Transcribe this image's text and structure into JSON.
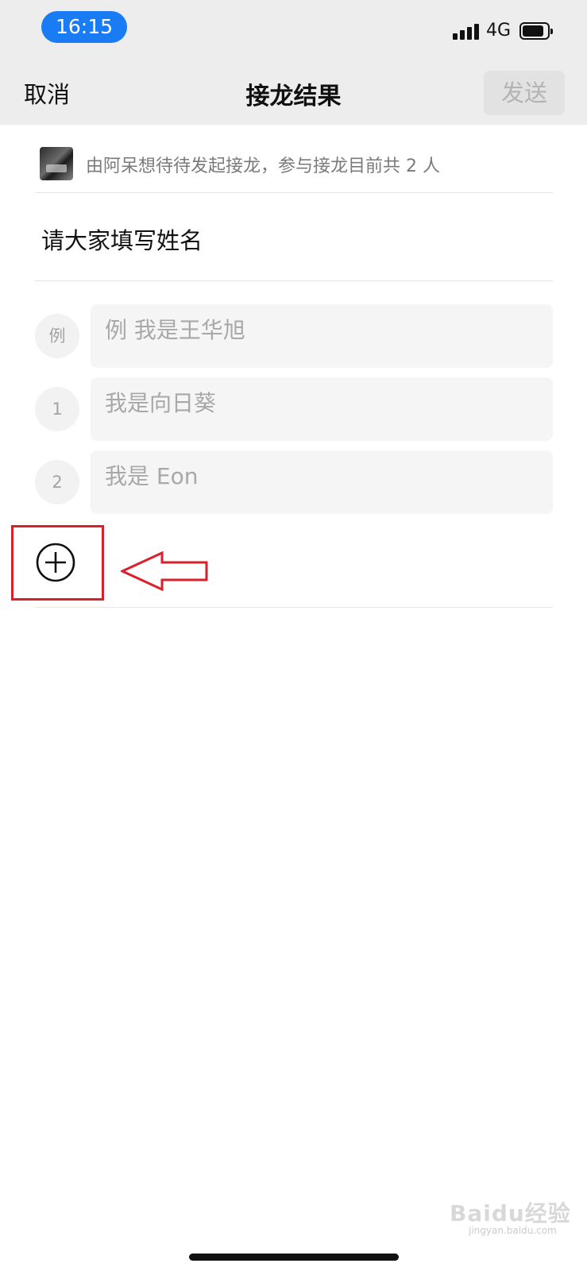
{
  "status_bar": {
    "time": "16:15",
    "network": "4G",
    "signal_icon": "signal-bars-icon",
    "battery_icon": "battery-icon"
  },
  "nav": {
    "cancel_label": "取消",
    "title": "接龙结果",
    "send_label": "发送"
  },
  "initiator": {
    "text": "由阿呆想待待发起接龙，参与接龙目前共 2 人"
  },
  "topic": {
    "text": "请大家填写姓名"
  },
  "entries": [
    {
      "index": "例",
      "value": "例 我是王华旭"
    },
    {
      "index": "1",
      "value": "我是向日葵"
    },
    {
      "index": "2",
      "value": "我是 Eon"
    }
  ],
  "add_button_icon": "plus-circle-icon",
  "annotation": {
    "highlight_color": "#d9202b",
    "arrow_icon": "left-arrow-icon"
  },
  "watermark": {
    "text": "Baidu经验",
    "sub": "jingyan.baidu.com"
  },
  "colors": {
    "accent": "#1a7cf5",
    "nav_background": "#ededed"
  }
}
